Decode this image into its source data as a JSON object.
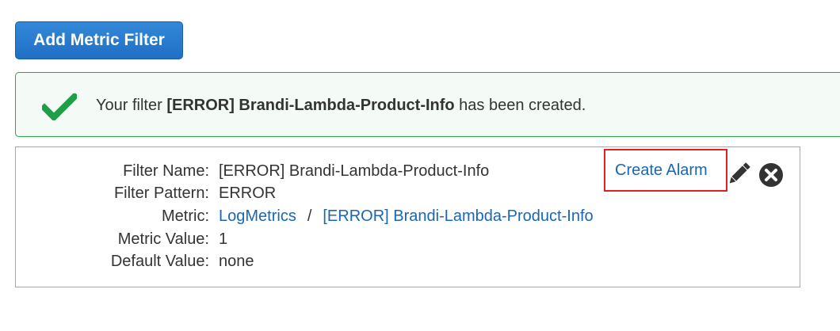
{
  "toolbar": {
    "add_metric_filter_label": "Add Metric Filter"
  },
  "banner": {
    "prefix": "Your filter ",
    "filter_name": "[ERROR] Brandi-Lambda-Product-Info",
    "suffix": " has been created.",
    "icon": "check-icon",
    "color": "#1e9e47"
  },
  "filter": {
    "name_label": "Filter Name:",
    "name_value": "[ERROR] Brandi-Lambda-Product-Info",
    "pattern_label": "Filter Pattern:",
    "pattern_value": "ERROR",
    "metric_label": "Metric:",
    "metric_namespace": "LogMetrics",
    "metric_separator": "/",
    "metric_name": "[ERROR] Brandi-Lambda-Product-Info",
    "metric_value_label": "Metric Value:",
    "metric_value": "1",
    "default_value_label": "Default Value:",
    "default_value": "none",
    "create_alarm_label": "Create Alarm",
    "edit_icon": "pencil-icon",
    "delete_icon": "close-circle-icon",
    "highlight_color": "#e02020",
    "link_color": "#1a66b5"
  }
}
